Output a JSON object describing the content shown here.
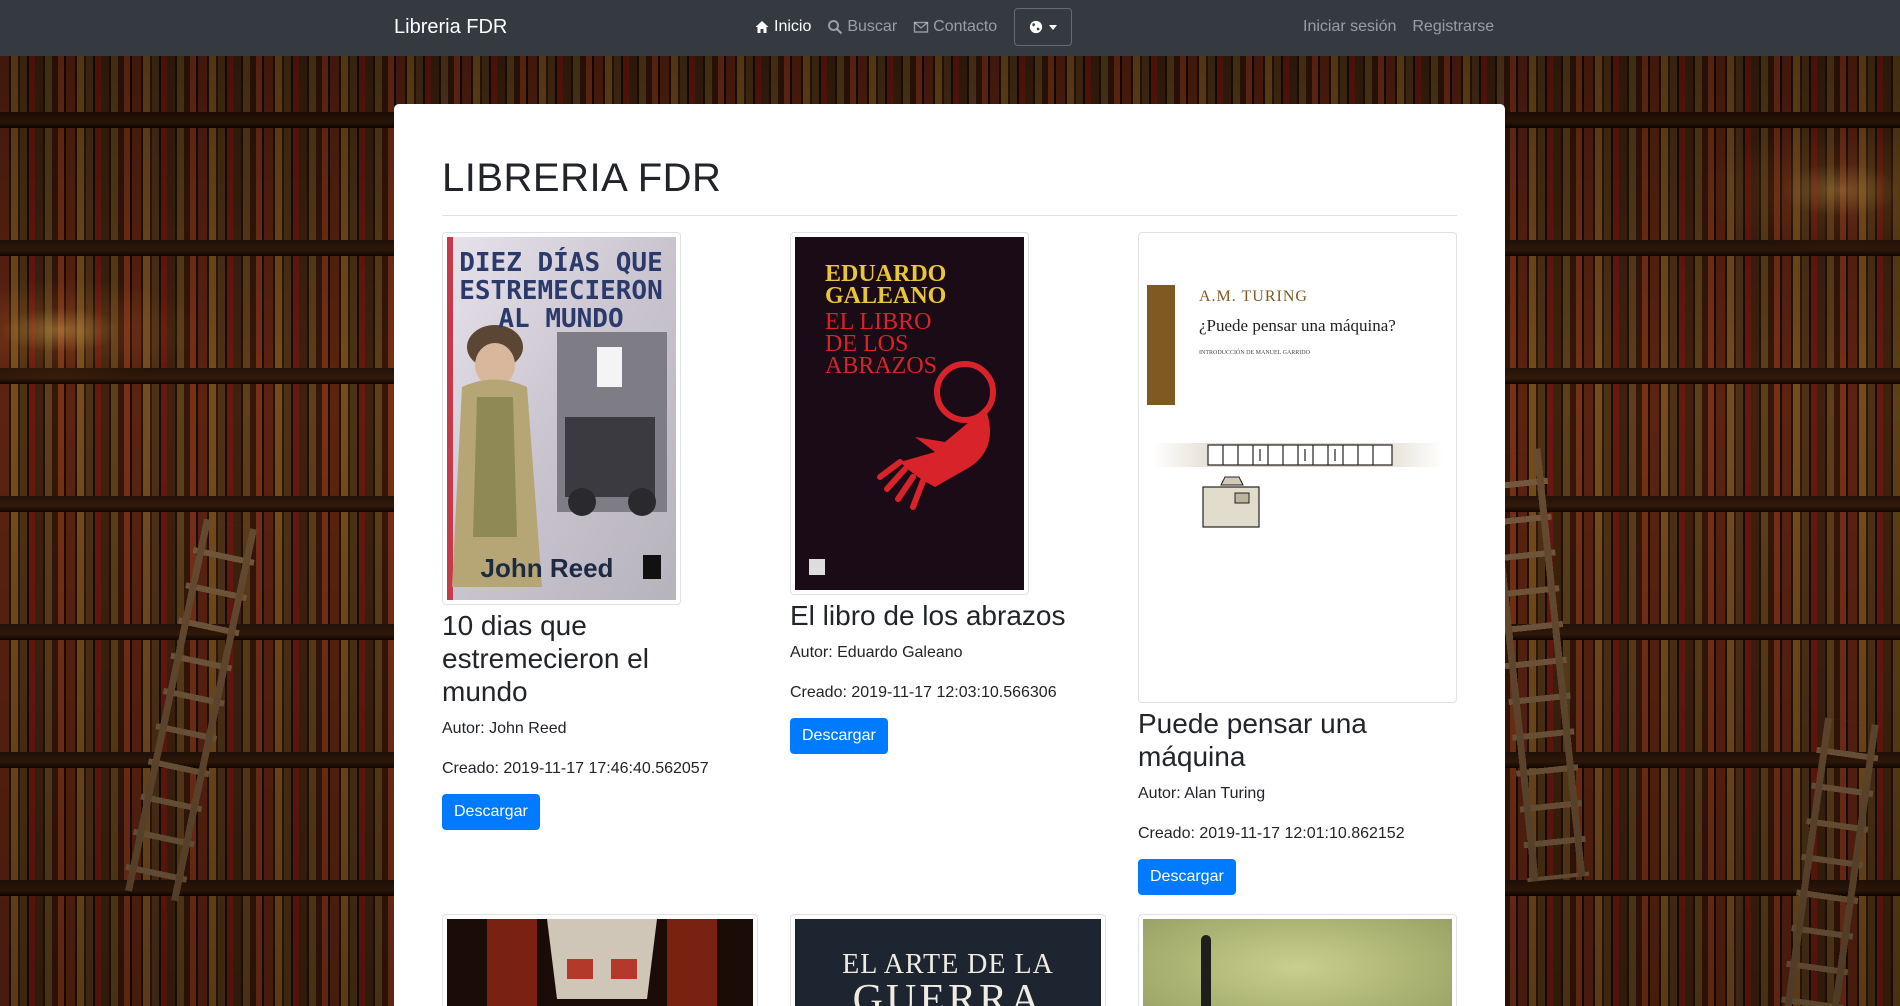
{
  "navbar": {
    "brand": "Libreria FDR",
    "links": [
      {
        "label": "Inicio",
        "icon": "home-icon",
        "active": true
      },
      {
        "label": "Buscar",
        "icon": "search-icon",
        "active": false
      },
      {
        "label": "Contacto",
        "icon": "envelope-icon",
        "active": false
      }
    ],
    "language_icon": "globe-icon",
    "login": "Iniciar sesión",
    "register": "Registrarse"
  },
  "page": {
    "title": "LIBRERIA FDR"
  },
  "books": [
    {
      "title": "10 dias que estremecieron el mundo",
      "author": "Autor: John Reed",
      "created": "Creado: 2019-11-17 17:46:40.562057",
      "button": "Descargar",
      "cover_text": [
        "DIEZ DÍAS QUE",
        "ESTREMECIERON",
        "AL MUNDO",
        "John Reed"
      ]
    },
    {
      "title": "El libro de los abrazos",
      "author": "Autor: Eduardo Galeano",
      "created": "Creado: 2019-11-17 12:03:10.566306",
      "button": "Descargar",
      "cover_text": [
        "EDUARDO",
        "GALEANO",
        "EL LIBRO",
        "DE LOS",
        "ABRAZOS"
      ]
    },
    {
      "title": "Puede pensar una máquina",
      "author": "Autor: Alan Turing",
      "created": "Creado: 2019-11-17 12:01:10.862152",
      "button": "Descargar",
      "cover_text": [
        "A.M. TURING",
        "¿Puede pensar una máquina?",
        "INTRODUCCIÓN DE MANUEL GARRIDO"
      ]
    }
  ],
  "partial_books": [
    {
      "cover_text": []
    },
    {
      "cover_text": [
        "EL ARTE DE LA",
        "GUERRA"
      ]
    },
    {
      "cover_text": []
    }
  ],
  "colors": {
    "navbar": "#343a40",
    "primary": "#007bff"
  }
}
